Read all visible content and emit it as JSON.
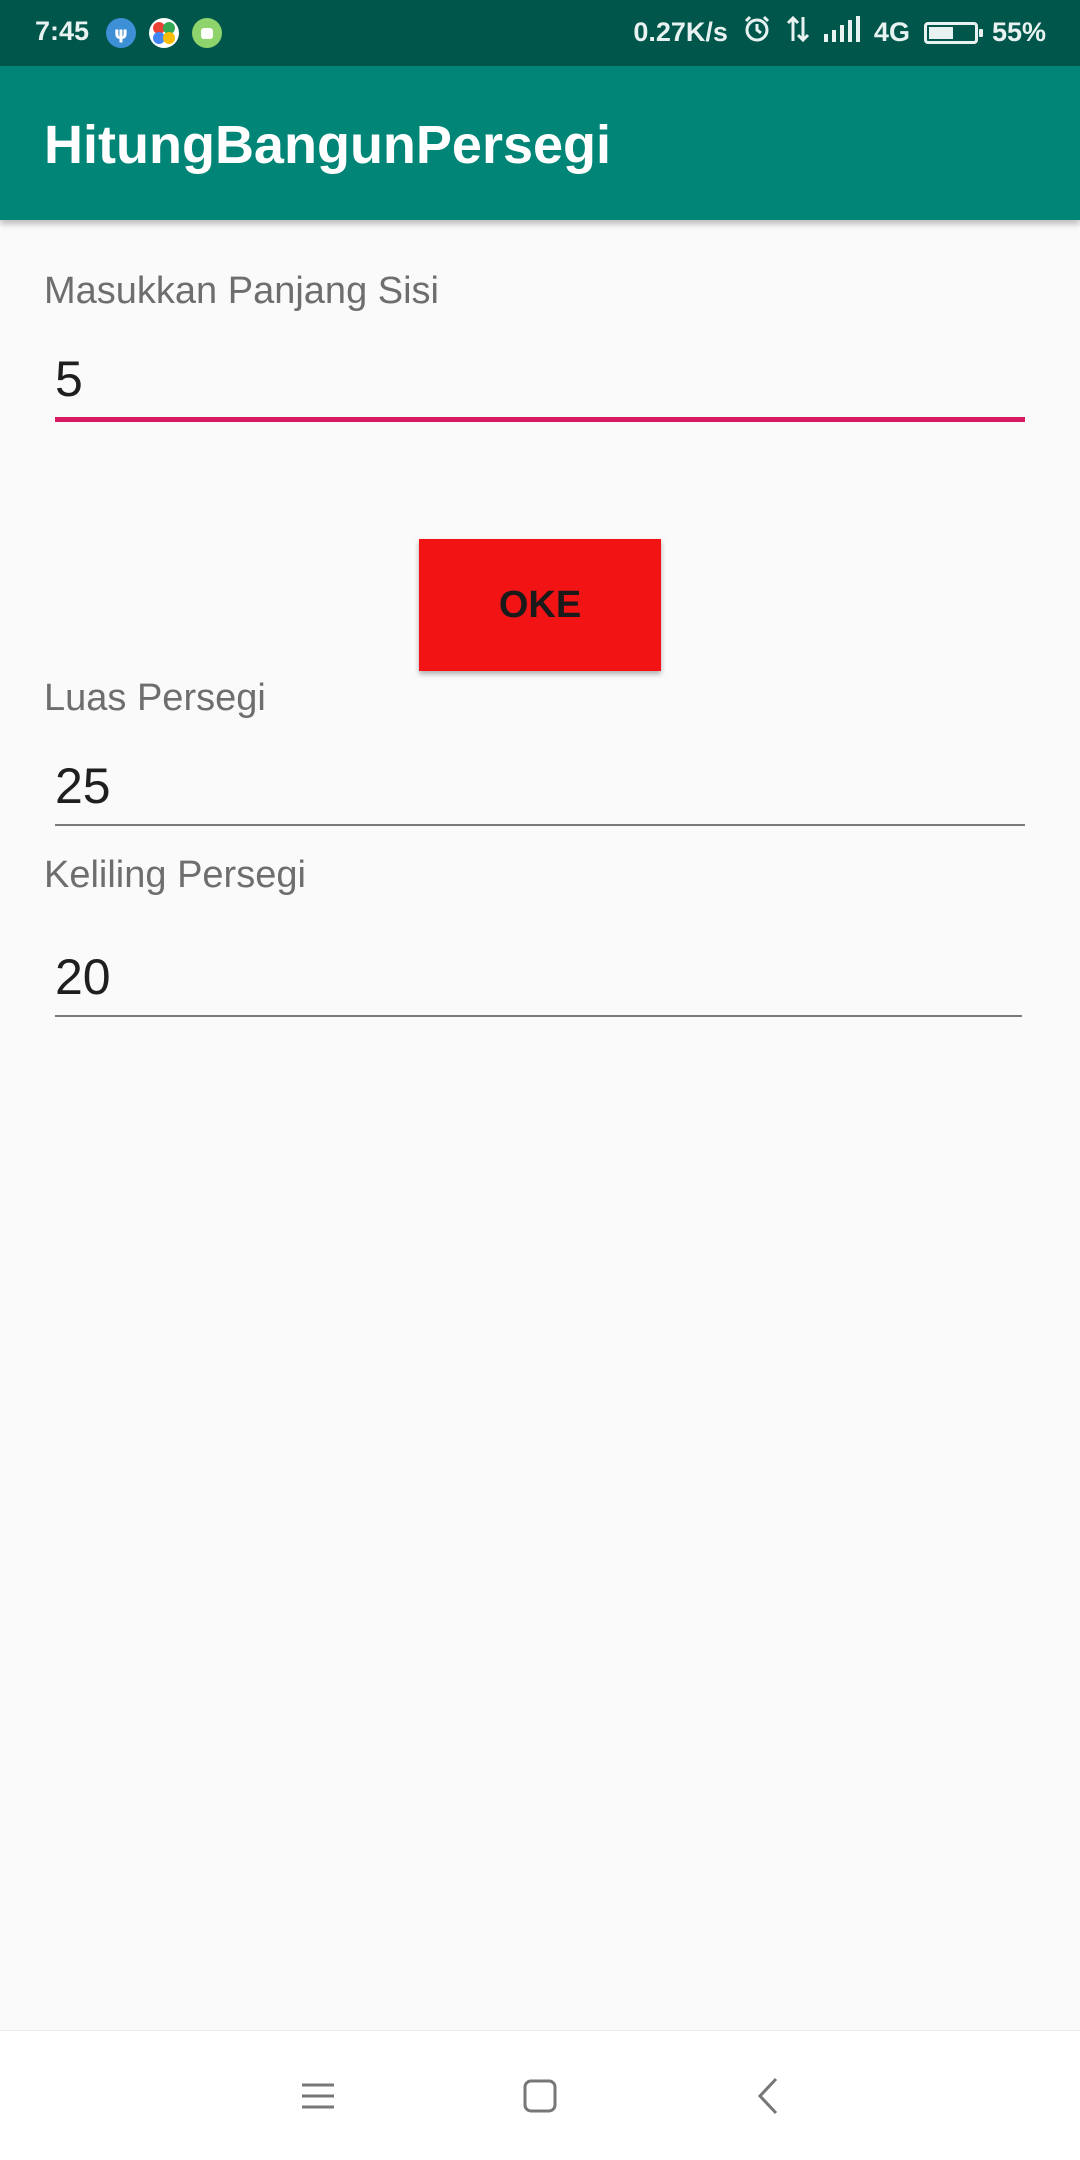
{
  "status_bar": {
    "time": "7:45",
    "network_speed": "0.27K/s",
    "network_type": "4G",
    "battery_percent": "55%",
    "battery_level": 0.55,
    "notification_icons": [
      "usb-debug-icon",
      "app-notification-icon",
      "android-icon"
    ],
    "status_icons": [
      "alarm-icon",
      "data-transfer-icon",
      "signal-icon",
      "battery-icon"
    ]
  },
  "app_bar": {
    "title": "HitungBangunPersegi"
  },
  "form": {
    "side_label": "Masukkan Panjang Sisi",
    "side_value": "5",
    "button_label": "OKE",
    "area_label": "Luas Persegi",
    "area_value": "25",
    "perimeter_label": "Keliling Persegi",
    "perimeter_value": "20"
  },
  "nav_bar": {
    "buttons": [
      "menu-icon",
      "home-icon",
      "back-icon"
    ]
  },
  "colors": {
    "status_bar": "#00564b",
    "app_bar": "#008577",
    "accent": "#d81b60",
    "button": "#f21414",
    "background": "#fafafa"
  }
}
